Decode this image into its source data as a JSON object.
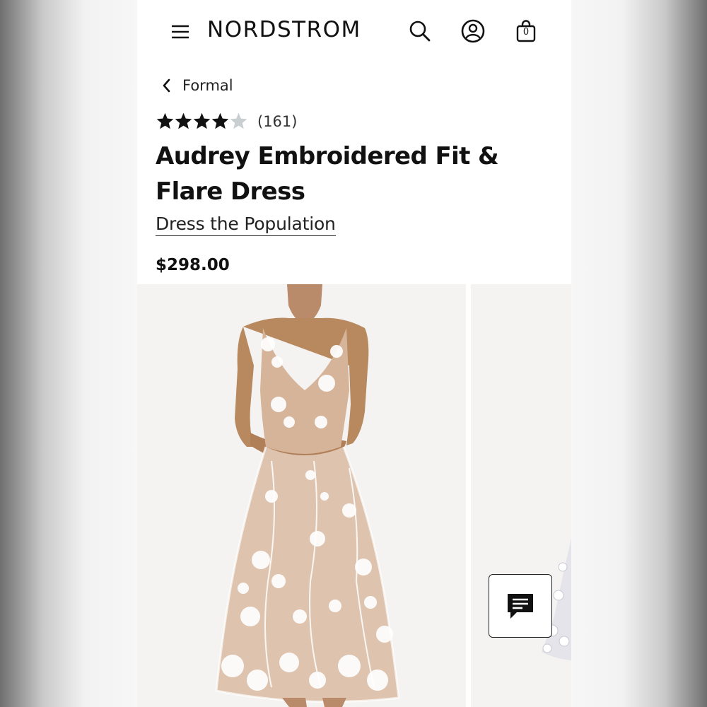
{
  "header": {
    "logo": "NORDSTROM",
    "icons": [
      "menu-icon",
      "search-icon",
      "account-icon",
      "shopping-bag-icon"
    ],
    "bag_count": "0"
  },
  "breadcrumb": {
    "label": "Formal"
  },
  "product": {
    "rating": 4,
    "rating_max": 5,
    "review_count": "(161)",
    "title": "Audrey Embroidered Fit & Flare Dress",
    "brand": "Dress the Population",
    "price": "$298.00"
  },
  "gallery": {
    "images": [
      "dress-front-photo",
      "dress-side-photo"
    ]
  },
  "chat": {
    "icon": "chat-icon"
  },
  "colors": {
    "star_filled": "#111111",
    "star_empty": "#c9ced1",
    "text": "#111111"
  }
}
